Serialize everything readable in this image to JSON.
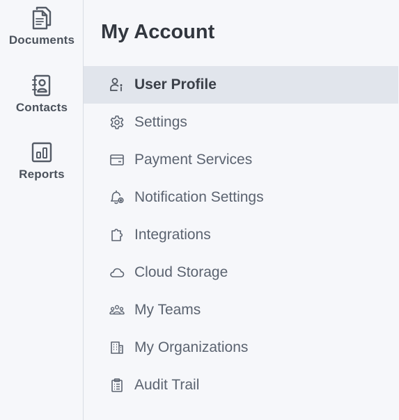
{
  "rail": {
    "items": [
      {
        "label": "Documents",
        "icon": "documents-icon"
      },
      {
        "label": "Contacts",
        "icon": "contacts-icon"
      },
      {
        "label": "Reports",
        "icon": "reports-icon"
      }
    ]
  },
  "main": {
    "title": "My Account",
    "menu": [
      {
        "label": "User Profile",
        "icon": "user-profile-icon",
        "active": true
      },
      {
        "label": "Settings",
        "icon": "gear-icon"
      },
      {
        "label": "Payment Services",
        "icon": "card-icon"
      },
      {
        "label": "Notification Settings",
        "icon": "bell-gear-icon"
      },
      {
        "label": "Integrations",
        "icon": "puzzle-icon"
      },
      {
        "label": "Cloud Storage",
        "icon": "cloud-icon"
      },
      {
        "label": "My Teams",
        "icon": "team-icon"
      },
      {
        "label": "My Organizations",
        "icon": "building-icon"
      },
      {
        "label": "Audit Trail",
        "icon": "clipboard-icon"
      }
    ]
  },
  "colors": {
    "active_bg": "#e1e5ec",
    "text": "#5b6370",
    "border": "#d9dde3"
  }
}
